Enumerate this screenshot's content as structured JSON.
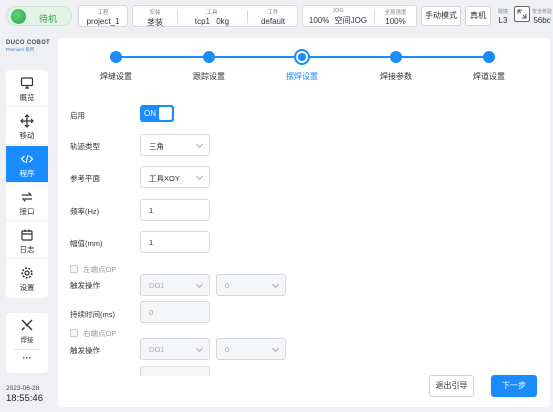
{
  "status": {
    "label": "待机"
  },
  "info": {
    "project": {
      "label": "工程",
      "value": "project_1"
    },
    "install": {
      "label": "安装",
      "value": "茎装"
    },
    "tool": {
      "label": "工具",
      "value_name": "tcp1",
      "value_load": "0kg"
    },
    "workpiece": {
      "label": "工件",
      "value": "default"
    },
    "jog": {
      "label": "JOG",
      "value_percent": "100%",
      "value_mode": "空间JOG"
    },
    "global_speed": {
      "label": "全局速度",
      "value": "100%"
    }
  },
  "top_buttons": {
    "manual_mode": "手动模式",
    "real_machine": "真机"
  },
  "collision": {
    "label": "碰撞",
    "value": "L3"
  },
  "safety": {
    "label": "安全校验",
    "value": "56bc"
  },
  "logo": {
    "brand": "DUCO COBOT",
    "edition": "Premium 系列"
  },
  "sidebar": {
    "items": [
      {
        "label": "概览",
        "icon": "monitor-icon"
      },
      {
        "label": "移动",
        "icon": "move-icon"
      },
      {
        "label": "程序",
        "icon": "code-icon"
      },
      {
        "label": "接口",
        "icon": "interface-icon"
      },
      {
        "label": "日志",
        "icon": "calendar-icon"
      },
      {
        "label": "设置",
        "icon": "gear-icon"
      }
    ],
    "active_index": 2
  },
  "tools": {
    "weld_label": "焊接",
    "more": "···"
  },
  "datetime": {
    "date": "2023-06-28",
    "time": "18:55:46"
  },
  "steps": {
    "labels": [
      "焊缝设置",
      "跟踪设置",
      "摆焊设置",
      "焊接参数",
      "焊道设置"
    ],
    "current_index": 2
  },
  "form": {
    "enable_label": "启用",
    "enable_value": "ON",
    "trajectory_label": "轨迹类型",
    "trajectory_value": "三角",
    "plane_label": "参考平面",
    "plane_value": "工具XOY",
    "frequency_label": "频率(Hz)",
    "frequency_value": "1",
    "amplitude_label": "幅值(mm)",
    "amplitude_value": "1",
    "left_dwell_label": "左端点OP",
    "trigger_label_1": "触发操作",
    "left_do_value": "DO1",
    "left_state_value": "0",
    "duration_label": "持续时间(ms)",
    "duration_value": "0",
    "right_dwell_label": "右端点OP",
    "trigger_label_2": "触发操作",
    "right_do_value": "DO1",
    "right_state_value": "0"
  },
  "footer": {
    "exit_label": "退出引导",
    "next_label": "下一步"
  },
  "colors": {
    "accent": "#1a8cff",
    "status_green": "#2fa54d"
  }
}
